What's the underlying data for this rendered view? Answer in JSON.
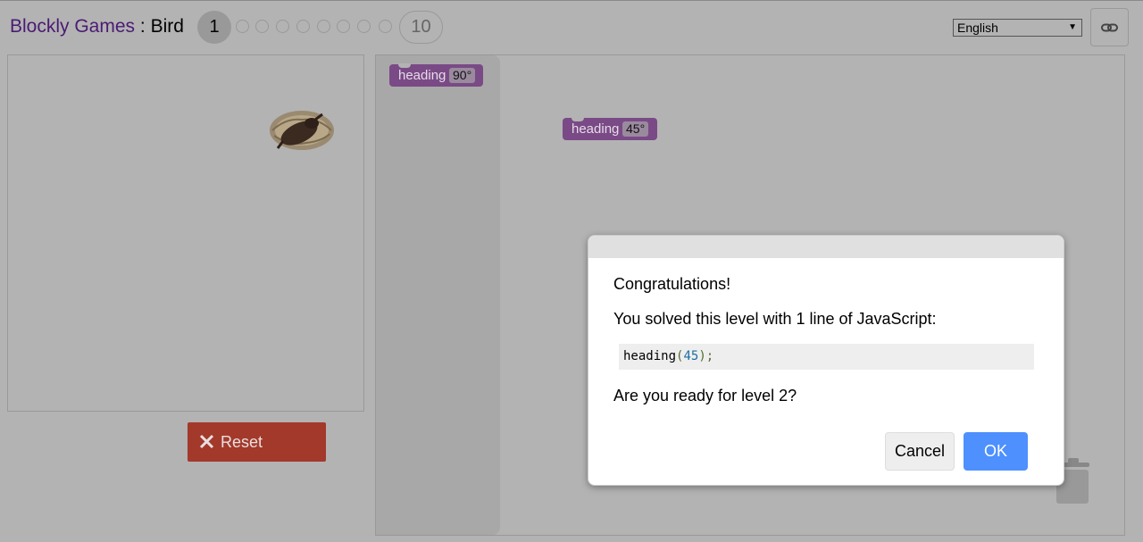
{
  "header": {
    "app_name": "Blockly Games",
    "separator": " : ",
    "game_name": "Bird",
    "levels": {
      "current": "1",
      "last": "10",
      "dot_count": 8
    },
    "language": {
      "selected": "English"
    },
    "link_button": {
      "icon": "link-icon"
    }
  },
  "left_panel": {
    "reset_button": {
      "label": "Reset",
      "icon": "close-icon",
      "color": "#a3392b"
    }
  },
  "workspace": {
    "flyout_block": {
      "keyword": "heading",
      "value": "90°"
    },
    "canvas_block": {
      "keyword": "heading",
      "value": "45°"
    },
    "block_color": "#7a4a86"
  },
  "dialog": {
    "title": "Congratulations!",
    "line": "You solved this level with 1 line of JavaScript:",
    "code": {
      "func": "heading",
      "open": "(",
      "arg": "45",
      "close": ");"
    },
    "question": "Are you ready for level 2?",
    "cancel_label": "Cancel",
    "ok_label": "OK",
    "ok_color": "#4d90fe"
  }
}
